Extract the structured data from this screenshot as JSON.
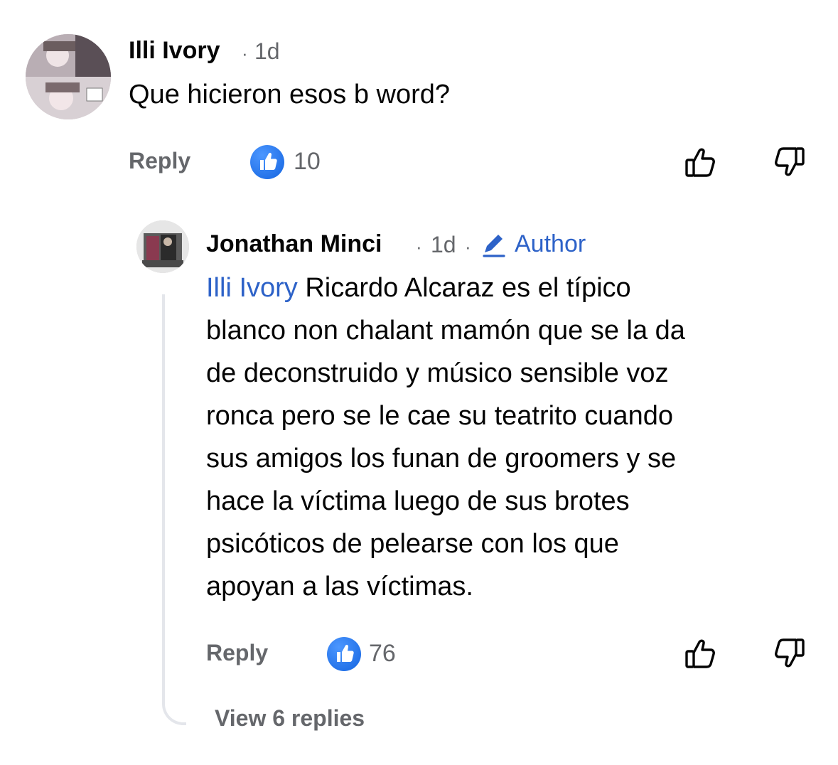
{
  "comment": {
    "author": "Illi Ivory",
    "time": "1d",
    "separator": "·",
    "text": "Que hicieron esos b word?",
    "reply_label": "Reply",
    "like_count": "10"
  },
  "reply": {
    "author": "Jonathan Minci",
    "time": "1d",
    "separator": "·",
    "author_badge": "Author",
    "mention": "Illi Ivory",
    "text_lines": [
      " Ricardo Alcaraz es el típico",
      "blanco non chalant mamón que se la da",
      "de deconstruido y músico sensible voz",
      "ronca pero se le cae su teatrito cuando",
      "sus amigos los funan de groomers y se",
      "hace la víctima luego de sus brotes",
      "psicóticos de pelearse con los que",
      "apoyan a las víctimas."
    ],
    "reply_label": "Reply",
    "like_count": "76"
  },
  "view_replies": "View 6 replies",
  "colors": {
    "accent_blue": "#2d62c8",
    "like_blue": "#1877f2",
    "secondary_text": "#65676b",
    "thread_line": "#e4e6eb"
  },
  "icons": [
    "like-badge-icon",
    "thumbs-up-icon",
    "thumbs-down-icon",
    "pencil-icon"
  ]
}
